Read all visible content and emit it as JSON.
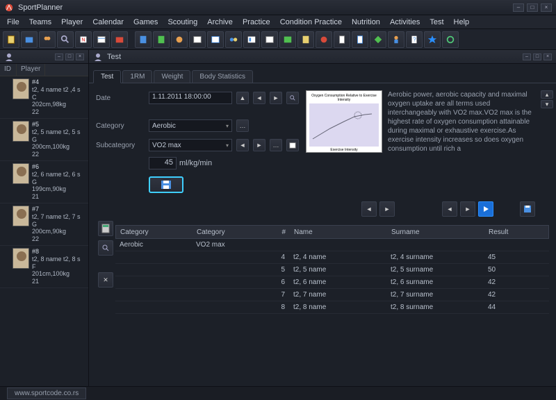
{
  "app": {
    "title": "SportPlanner"
  },
  "menu": [
    "File",
    "Teams",
    "Player",
    "Calendar",
    "Games",
    "Scouting",
    "Archive",
    "Practice",
    "Condition Practice",
    "Nutrition",
    "Activities",
    "Test",
    "Help"
  ],
  "sidebar": {
    "cols": {
      "id": "ID",
      "player": "Player"
    },
    "players": [
      {
        "num": "#4",
        "name": "t2, 4 name t2 ,4 s",
        "g": "C",
        "hw": "202cm,98kg",
        "age": "22"
      },
      {
        "num": "#5",
        "name": "t2, 5 name t2, 5 s",
        "g": "G",
        "hw": "200cm,100kg",
        "age": "22"
      },
      {
        "num": "#6",
        "name": "t2, 6 name t2, 6 s",
        "g": "G",
        "hw": "199cm,90kg",
        "age": "21"
      },
      {
        "num": "#7",
        "name": "t2, 7 name t2, 7 s",
        "g": "G",
        "hw": "200cm,90kg",
        "age": "22"
      },
      {
        "num": "#8",
        "name": "t2, 8 name t2, 8 s",
        "g": "F",
        "hw": "201cm,100kg",
        "age": "21"
      }
    ]
  },
  "panel": {
    "title": "Test"
  },
  "tabs": [
    "Test",
    "1RM",
    "Weight",
    "Body Statistics"
  ],
  "form": {
    "date_label": "Date",
    "date_value": "1.11.2011 18:00:00",
    "category_label": "Category",
    "category_value": "Aerobic",
    "subcategory_label": "Subcategory",
    "subcategory_value": "VO2 max",
    "value": "45",
    "unit": "ml/kg/min"
  },
  "description": "Aerobic power, aerobic capacity and maximal oxygen uptake are all terms used interchangeably with VO2 max.VO2 max is the highest rate of oxygen consumption attainable during maximal or exhaustive exercise.As exercise intensity increases so does oxygen consumption until rich a",
  "chart_thumb": {
    "title": "Oxygen Consumption Relative to Exercise Intensity",
    "xlabel": "Exercise Intensity"
  },
  "grid": {
    "left_head1": "Category",
    "left_head2": "Category",
    "left_val1": "Aerobic",
    "left_val2": "VO2 max",
    "head": {
      "num": "#",
      "name": "Name",
      "surname": "Surname",
      "result": "Result"
    },
    "rows": [
      {
        "num": "4",
        "name": "t2, 4 name",
        "surname": "t2, 4 surname",
        "result": "45"
      },
      {
        "num": "5",
        "name": "t2, 5 name",
        "surname": "t2, 5 surname",
        "result": "50"
      },
      {
        "num": "6",
        "name": "t2, 6 name",
        "surname": "t2, 6 surname",
        "result": "42"
      },
      {
        "num": "7",
        "name": "t2, 7 name",
        "surname": "t2, 7 surname",
        "result": "42"
      },
      {
        "num": "8",
        "name": "t2, 8 name",
        "surname": "t2, 8 surname",
        "result": "44"
      }
    ]
  },
  "footer": {
    "link": "www.sportcode.co.rs"
  }
}
